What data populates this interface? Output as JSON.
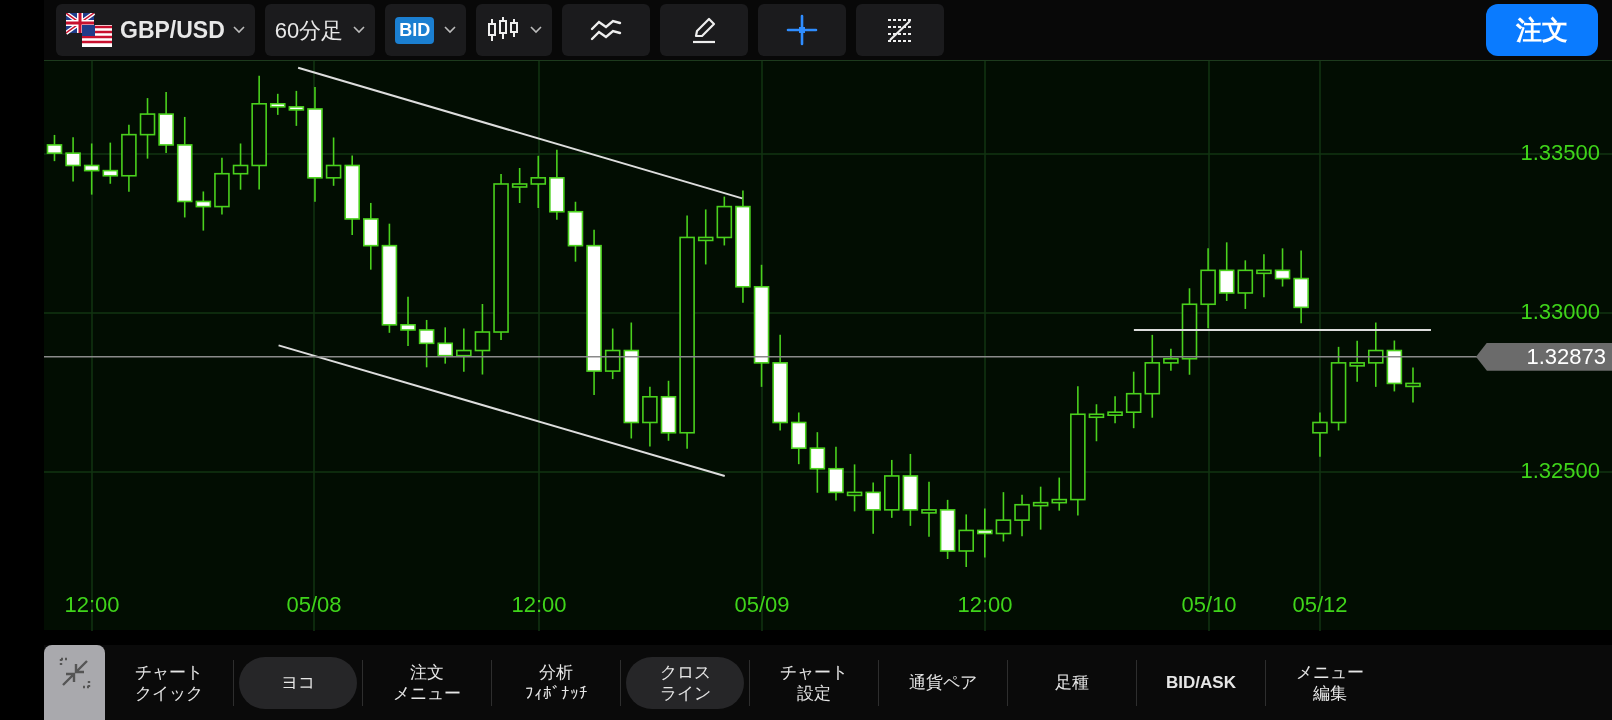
{
  "toolbar": {
    "symbol": {
      "label": "GBP/USD"
    },
    "timeframe": {
      "label": "60分足"
    },
    "price_type": {
      "label": "BID"
    },
    "tools": [
      {
        "kind": "indicator",
        "selected": false
      },
      {
        "kind": "draw",
        "selected": false
      },
      {
        "kind": "crosshair",
        "selected": true
      },
      {
        "kind": "lines",
        "selected": false
      }
    ],
    "order_button": "注文"
  },
  "chart": {
    "y_ticks": [
      "1.33500",
      "1.33000",
      "1.32500"
    ],
    "current_price": "1.32873",
    "x_labels": [
      "12:00",
      "05/08",
      "12:00",
      "05/09",
      "12:00",
      "05/10",
      "05/12"
    ]
  },
  "bottom_menu": [
    {
      "lines": [
        "チャート",
        "クイック"
      ],
      "selected": false
    },
    {
      "lines": [
        "ヨコ"
      ],
      "selected": true
    },
    {
      "lines": [
        "注文",
        "メニュー"
      ],
      "selected": false
    },
    {
      "lines": [
        "分析",
        "ﾌｨﾎﾞﾅｯﾁ"
      ],
      "selected": false
    },
    {
      "lines": [
        "クロス",
        "ライン"
      ],
      "selected": true
    },
    {
      "lines": [
        "チャート",
        "設定"
      ],
      "selected": false
    },
    {
      "lines": [
        "通貨ペア"
      ],
      "selected": false
    },
    {
      "lines": [
        "足種"
      ],
      "selected": false
    },
    {
      "lines": [
        "BID/ASK"
      ],
      "selected": false
    },
    {
      "lines": [
        "メニュー",
        "編集"
      ],
      "selected": false
    }
  ]
}
